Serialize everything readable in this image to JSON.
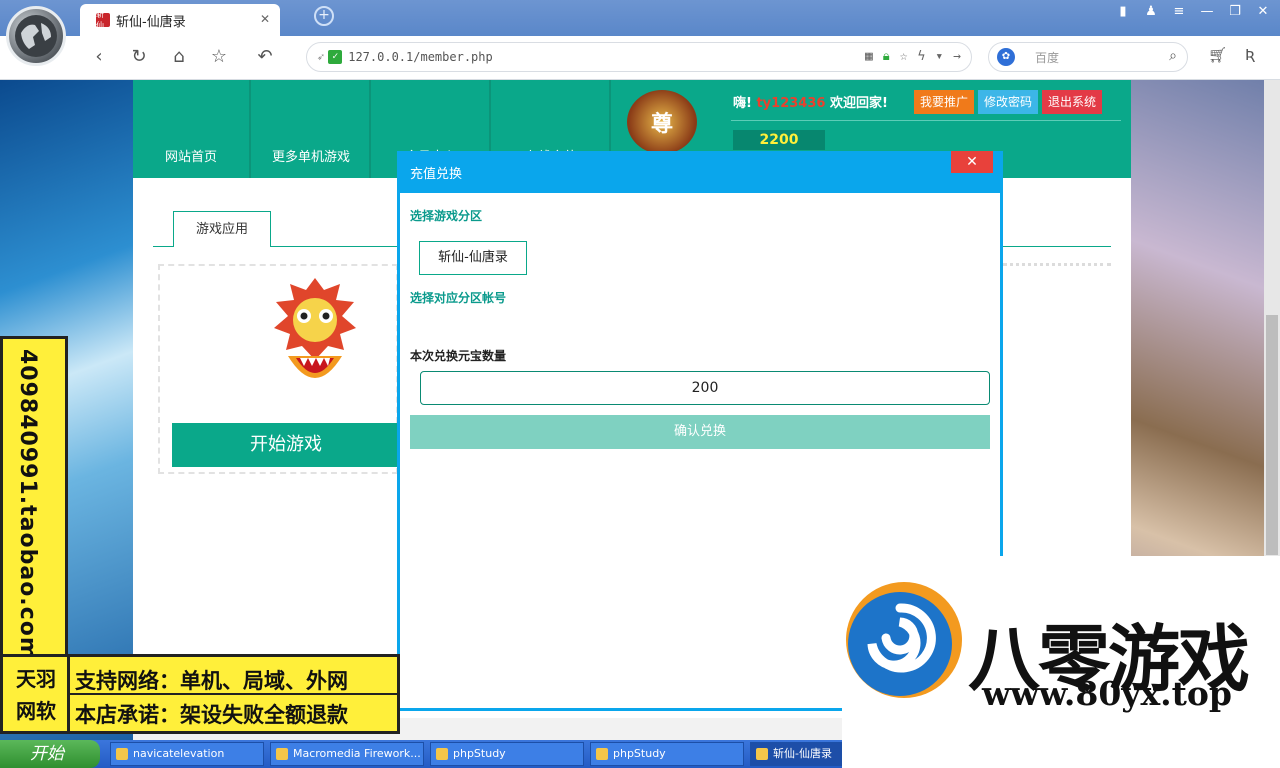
{
  "browser": {
    "tab_title": "斩仙-仙唐录",
    "favicon_text": "斩仙",
    "url": "127.0.0.1/member.php",
    "search_placeholder": "百度"
  },
  "site": {
    "nav": [
      "网站首页",
      "更多单机游戏",
      "会员中心",
      "在线充值"
    ],
    "greeting_prefix": "嗨!",
    "username": "ty123436",
    "greeting_suffix": "欢迎回家!",
    "buttons": {
      "promote": "我要推广",
      "change_password": "修改密码",
      "logout": "退出系统"
    },
    "crest_char": "尊",
    "coins": "2200",
    "content_tab": "游戏应用",
    "start_game": "开始游戏"
  },
  "modal": {
    "title": "充值兑换",
    "close": "✕",
    "select_zone_label": "选择游戏分区",
    "zone_value": "斩仙-仙唐录",
    "select_account_label": "选择对应分区帐号",
    "amount_label": "本次兑换元宝数量",
    "amount_value": "200",
    "confirm": "确认兑换"
  },
  "ads": {
    "vertical": "409840991.taobao.com",
    "brand_line1": "天羽",
    "brand_line2": "网软",
    "line1": "支持网络：单机、局域、外网",
    "line2": "本店承诺：架设失败全额退款"
  },
  "watermark": {
    "name": "八零游戏",
    "url": "www.80yx.top"
  },
  "taskbar": {
    "start": "开始",
    "items": [
      "navicatelevation",
      "Macromedia Firework...",
      "phpStudy",
      "phpStudy",
      "斩仙-仙唐录"
    ]
  },
  "colors": {
    "site_green": "#0aa88a",
    "modal_blue": "#0aa6ec",
    "close_red": "#e8413b",
    "ad_yellow": "#ffef3a"
  },
  "icons": [
    "globe-icon",
    "back-icon",
    "refresh-icon",
    "home-icon",
    "star-icon",
    "undo-icon",
    "qr-icon",
    "lock-icon",
    "search-icon",
    "cart-icon"
  ]
}
